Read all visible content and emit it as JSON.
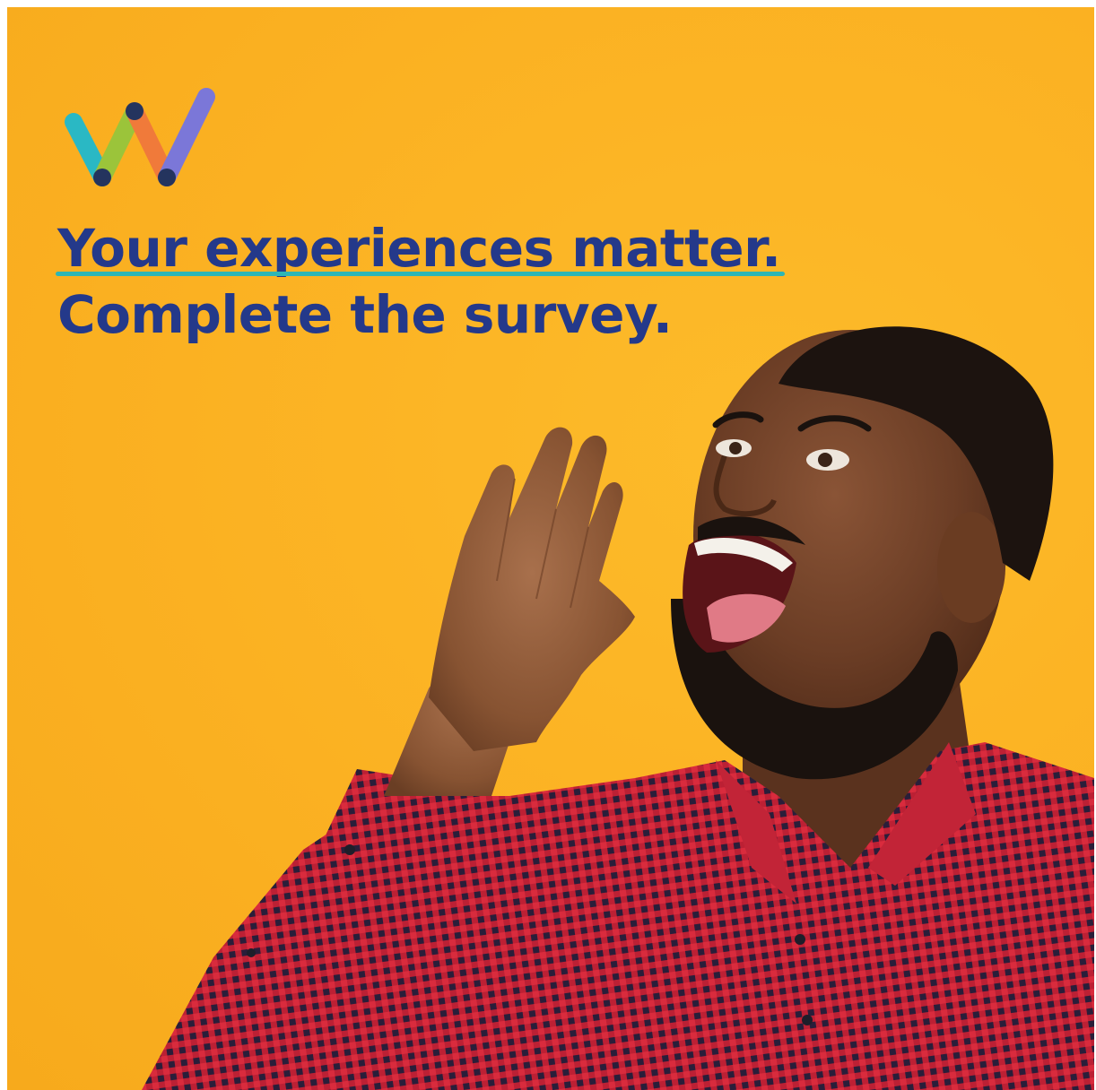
{
  "headline": {
    "line1": "Your experiences matter.",
    "line2": "Complete the survey."
  },
  "colors": {
    "background": "#FBB122",
    "headline": "#24398A",
    "underline": "#2EB6B5",
    "logo_teal": "#2AB8C4",
    "logo_green": "#9BC43A",
    "logo_orange": "#F07A3A",
    "logo_purple": "#7B77D8",
    "logo_navy": "#24345E",
    "shirt": "#D92B3D"
  },
  "icons": {
    "logo": "w-brand-logo-icon"
  }
}
